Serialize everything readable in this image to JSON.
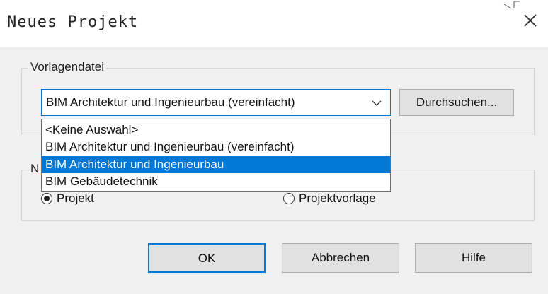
{
  "window": {
    "title": "Neues Projekt",
    "close_label": "✕"
  },
  "template_group": {
    "label": "Vorlagendatei",
    "selected_value": "BIM Architektur und Ingenieurbau (vereinfacht)",
    "browse_label": "Durchsuchen...",
    "options": [
      "<Keine Auswahl>",
      "BIM Architektur und Ingenieurbau (vereinfacht)",
      "BIM Architektur und Ingenieurbau",
      "BIM Gebäudetechnik"
    ],
    "highlighted_option_index": 2
  },
  "create_group": {
    "label_partial": "N",
    "options": [
      {
        "label": "Projekt",
        "checked": true
      },
      {
        "label": "Projektvorlage",
        "checked": false
      }
    ]
  },
  "buttons": {
    "ok": "OK",
    "cancel": "Abbrechen",
    "help": "Hilfe"
  },
  "colors": {
    "accent": "#0078d7",
    "dialog_bg": "#f0f0f0",
    "button_bg": "#e1e1e1"
  }
}
